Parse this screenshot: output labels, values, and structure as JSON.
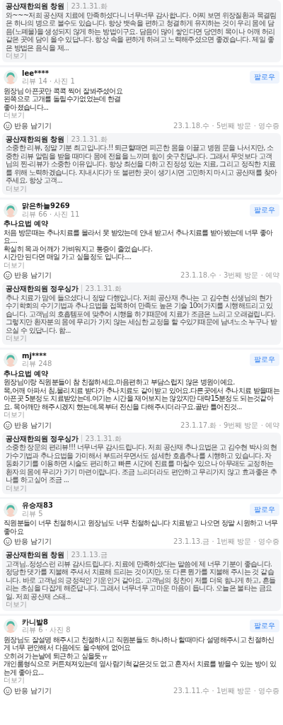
{
  "top_reply": {
    "author": "공산재한의원 창원",
    "date": "23.1.31.화",
    "text": "와~~~저희 공산재 치료에 만족하셨다니 너무너무 감사합니다. 어찌 보면 위장질환과 목결림은 하나의 병으로 볼수도 있습니다. 항상 뱃속을 편하고 청결하게 유지하는 것이 우리 몸에 담음(노폐물)을 생성되지 않게 하는 방법이구요. 담음이 많이 쌓인다면 당연히 목이나 어깨 허리같은 곳에 담이 올수 있답니다. 항상 속을 편하게 하려고 노력해주셨으면 좋겠습니다. 제일 좋은 방법은 음식을 제...",
    "more": "더보기"
  },
  "reviews": [
    {
      "name": "lee****",
      "stats": "리뷰 14 · 사진 1",
      "follow": "팔로우",
      "body": [
        "원장님 아픈곳만 콕콕 찍어 잘봐주셨어요",
        "왼쪽으로 고개를 돌릴수가없었는데 한결",
        "좋아졌습니다..."
      ],
      "more": "더보기",
      "react": "반응 남기기",
      "meta": "23.1.18.수 · 5번째 방문 · 영수증",
      "reply": {
        "author": "공산재한의원 창원",
        "date": "23.1.31.화",
        "text": "소중한 리뷰, 정말 기분 최고입니다.!! 퇴근할때면 피곤한 몸을 이끌고 병원 문을 나서지만, 소중한 리뷰 알림을 받을 때마다 몸에 전율을 느끼며 힘이 솟구친답니다. 그래서 무엇보다 고객님의 찐-리뷰가 소중한 이유입니다. 항상 최선을 다하고 진정성 있는 치료, 그리고 정직한 치료를 위해 노력하겠습니다. 지내시다가 또 불편한 곳이 생기시면 고민하지 마시고 공산재를 찾아주세요. 항상 고객...",
        "more": "더보기"
      }
    },
    {
      "name": "맑은하늘9269",
      "stats": "리뷰 66 · 사진 11",
      "follow": "팔로우",
      "tag": "추나요법 예약",
      "body": [
        "처음 방문때는 추나치료를 몰라서 못 받았는데 안내 받고서 추나치료를 받아봤는데 너무 좋아요....",
        "확실히 목과 어깨가 가벼워지고 통증이 줄었습니다.",
        "시간만 된다면 매일 가고 싶을정도 입니다...."
      ],
      "more": "더보기",
      "react": "반응 남기기",
      "meta": "23.1.18.수 · 3번째 방문 · 예약",
      "reply": {
        "author": "공산재한의원 정우싱가",
        "date": "23.1.31.화",
        "text": "추나 치료가 맘에 들으셨다니 정말 다행입니다. 저희 공산재 추나는 고 김수현 선생님의 현가수기학회의 수기기법과 추나요법을 접목하여 만족도 높은 기술 10여가지를 시행해드리고 있습니다. 고객님의 호흡템포에 맞추어 시행을 하기때문에 치료가 조금은 느리고 오래걸립니다. 그렇지만 환자분의 몸에 무리가 가지 않는 세심한 교정을 할 수있기때문에 남녀노소 누구나 받으실 수 있답니다. 함...",
        "more": "더보기"
      }
    },
    {
      "name": "mj****",
      "stats": "리뷰 248",
      "follow": "팔로우",
      "tag": "추나요법 예약",
      "body": [
        "원장님이랑 직원분들이 참 친절하세요.마음편하고 부담스럽지 않은 병원이예요.",
        "목,어깨 아파서 침,물리치료 받다가 추나치료도 같이받고 있어요.다른곳에서 추나치료 받을때는 아픈곳 5분정도 치료받았는데.여기는 시간을 재어보지는 않았지만 대략15분정도 되는것같아요. 목어깨만 해주시겠지 했는데.목부터 전신을 다해주시더라구요.골반 틀어진것..."
      ],
      "more": "더보기",
      "react": "반응 남기기",
      "meta": "23.1.17.화 · 9번째 방문 · 예약",
      "reply": {
        "author": "공산재한의원 정우싱가",
        "date": "23.1.31.화",
        "text": "소중한 장문의 편리뷰!!! 너무너무 감사드립니다. 저희 공산재 추나요법은 고 김수현 박사의 현가수기법과 추나요법을 가미해서 부드러우면서도 섬세한 호흡추나를 시행하고 있습니다. 자동화기기를 이용하면 시술도 편리하고 빠른 시간에 진료를 마칠수 있으나 아무래도 교정하는 환자의 몸에 무리가 가기 마련이랍니다. 조금 느리더라도 편안하고 무리가지 않고 효과좋은 추나를 하고싶어 조금 ...",
        "more": "더보기"
      }
    },
    {
      "name": "유승재83",
      "stats": "리뷰 5",
      "follow": "팔로우",
      "body": [
        "직원분들이 너무 친절하시고 원장님도 너무 친절하십니다 치료받고 나오면 정말 시원하고 너무 좋아요"
      ],
      "react": "반응 남기기",
      "meta": "23.1.13.금 · 1번째 방문 · 영수증",
      "reply": {
        "author": "공산재한의원 창원",
        "date": "23.1.13.금",
        "text": "고객님..정성스런 리뷰 감사드립니다. 치료에 만족하셨다는 말씀에 제 너무 기분이 좋습니다. 정당한 댓가를 지불해 주셔서 치료해 드리는 것이지만, 또 다른 뭔가를 지불해 주시는 것 같습니다. 바로 고객님의 긍정적인 기운인거 같아요. 고객님의 칭찬이 저를 더욱 힘나게 하고, 흔들리는 초심을 다잡게 해준답니다. 그래서 너무너무 고마운 마음이 듭니다. 오늘은 불타는 금요일. 저희 공산재 스태...",
        "more": "더보기"
      }
    },
    {
      "name": "카니발8",
      "stats": "리뷰 6 · 사진 8",
      "follow": "팔로우",
      "body": [
        "원장님도 잘설명 해주시고 친절하시고 직원분들도 하나하나 할때마다 설명해주시고 친절하신게 너무 편안해서 다음에도 올수밖에 없어요",
        "오히려 가는날에 퇴근하고 싶을듯ㅠ",
        "개인룸형식으로 커튼쳐져있는데 옆사람기척같은것도 없고 혼자서 치료를 받을수 있는 방이 있는게 좋아요..."
      ],
      "more": "더보기",
      "react": "반응 남기기",
      "meta": "23.1.11.수 · 1번째 방문 · 영수증"
    }
  ]
}
